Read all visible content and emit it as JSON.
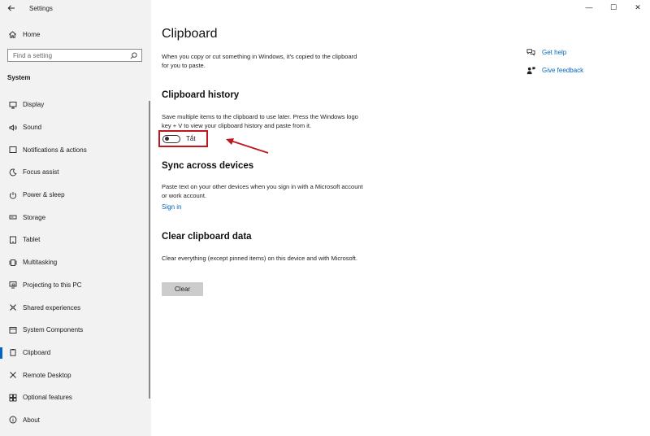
{
  "window": {
    "title": "Settings",
    "controls": {
      "minimize": "—",
      "maximize": "☐",
      "close": "✕"
    }
  },
  "sidebar": {
    "home_label": "Home",
    "search_placeholder": "Find a setting",
    "section_label": "System",
    "items": [
      {
        "label": "Display",
        "icon": "display-icon"
      },
      {
        "label": "Sound",
        "icon": "sound-icon"
      },
      {
        "label": "Notifications & actions",
        "icon": "notifications-icon"
      },
      {
        "label": "Focus assist",
        "icon": "focus-assist-icon"
      },
      {
        "label": "Power & sleep",
        "icon": "power-icon"
      },
      {
        "label": "Storage",
        "icon": "storage-icon"
      },
      {
        "label": "Tablet",
        "icon": "tablet-icon"
      },
      {
        "label": "Multitasking",
        "icon": "multitasking-icon"
      },
      {
        "label": "Projecting to this PC",
        "icon": "projecting-icon"
      },
      {
        "label": "Shared experiences",
        "icon": "shared-experiences-icon"
      },
      {
        "label": "System Components",
        "icon": "system-components-icon"
      },
      {
        "label": "Clipboard",
        "icon": "clipboard-icon",
        "active": true
      },
      {
        "label": "Remote Desktop",
        "icon": "remote-desktop-icon"
      },
      {
        "label": "Optional features",
        "icon": "optional-features-icon"
      },
      {
        "label": "About",
        "icon": "about-icon"
      }
    ]
  },
  "main": {
    "title": "Clipboard",
    "intro": "When you copy or cut something in Windows, it's copied to the clipboard for you to paste.",
    "history": {
      "heading": "Clipboard history",
      "description": "Save multiple items to the clipboard to use later. Press the Windows logo key + V to view your clipboard history and paste from it.",
      "toggle_label": "Tắt",
      "toggle_on": false
    },
    "sync": {
      "heading": "Sync across devices",
      "description": "Paste text on your other devices when you sign in with a Microsoft account or work account.",
      "link": "Sign in"
    },
    "clear": {
      "heading": "Clear clipboard data",
      "description": "Clear everything (except pinned items) on this device and with Microsoft.",
      "button": "Clear"
    }
  },
  "help": {
    "get_help": "Get help",
    "give_feedback": "Give feedback"
  },
  "colors": {
    "accent": "#0067c0",
    "annotation": "#c0161d",
    "sidebar_bg": "#f2f2f2"
  }
}
